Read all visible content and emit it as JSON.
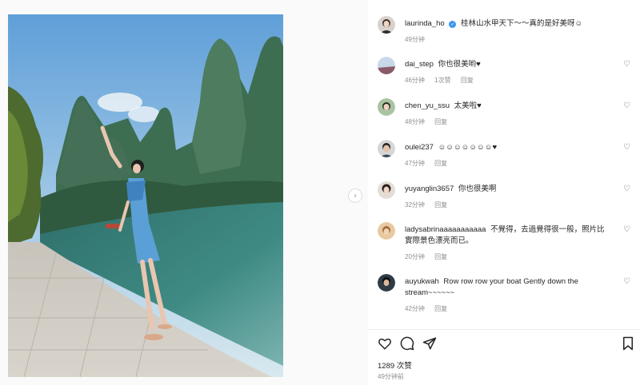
{
  "post": {
    "author": "laurinda_ho",
    "caption": "桂林山水甲天下～～真的是好美呀☺",
    "time": "49分钟"
  },
  "comments": [
    {
      "user": "dai_step",
      "text": "你也很美哟♥",
      "time": "46分钟",
      "likes": "1次赞",
      "reply": "回复"
    },
    {
      "user": "chen_yu_ssu",
      "text": "太美啦♥",
      "time": "48分钟",
      "reply": "回复"
    },
    {
      "user": "oulei237",
      "text": "☺☺☺☺☺☺☺♥",
      "time": "47分钟",
      "reply": "回复"
    },
    {
      "user": "yuyanglin3657",
      "text": "你也很美啊",
      "time": "32分钟",
      "reply": "回复"
    },
    {
      "user": "ladysabrinaaaaaaaaaaa",
      "text": "不覺得，去過覺得很一般，照片比實際景色漂亮而已。",
      "time": "20分钟",
      "reply": "回复"
    },
    {
      "user": "auyukwah",
      "text": "Row row row your boat Gently down the stream~~~~~~",
      "time": "42分钟",
      "reply": "回复"
    }
  ],
  "footer": {
    "likes_count": "1289 次赞",
    "posted": "49分钟前"
  },
  "icons": {
    "heart": "heart-icon",
    "comment": "comment-icon",
    "share": "share-icon",
    "save": "bookmark-icon",
    "next": "chevron-right-icon"
  },
  "colors": {
    "verified": "#3897f0",
    "secondary_text": "#8e8e8e"
  }
}
